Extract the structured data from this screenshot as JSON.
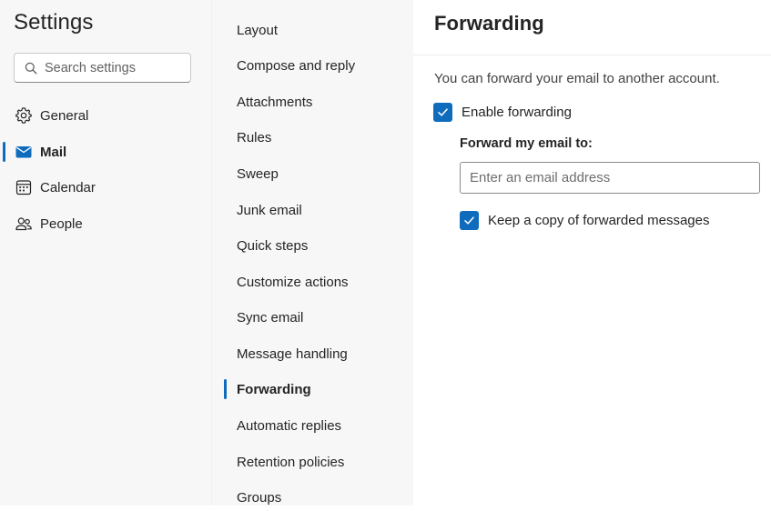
{
  "app": {
    "title": "Settings"
  },
  "search": {
    "placeholder": "Search settings",
    "icon": "search-icon"
  },
  "categories": [
    {
      "label": "General",
      "icon": "gear-icon",
      "active": false
    },
    {
      "label": "Mail",
      "icon": "mail-icon",
      "active": true
    },
    {
      "label": "Calendar",
      "icon": "calendar-icon",
      "active": false
    },
    {
      "label": "People",
      "icon": "people-icon",
      "active": false
    }
  ],
  "mail_sections": [
    {
      "label": "Layout",
      "active": false
    },
    {
      "label": "Compose and reply",
      "active": false
    },
    {
      "label": "Attachments",
      "active": false
    },
    {
      "label": "Rules",
      "active": false
    },
    {
      "label": "Sweep",
      "active": false
    },
    {
      "label": "Junk email",
      "active": false
    },
    {
      "label": "Quick steps",
      "active": false
    },
    {
      "label": "Customize actions",
      "active": false
    },
    {
      "label": "Sync email",
      "active": false
    },
    {
      "label": "Message handling",
      "active": false
    },
    {
      "label": "Forwarding",
      "active": true
    },
    {
      "label": "Automatic replies",
      "active": false
    },
    {
      "label": "Retention policies",
      "active": false
    },
    {
      "label": "Groups",
      "active": false
    }
  ],
  "forwarding": {
    "title": "Forwarding",
    "description": "You can forward your email to another account.",
    "enable_label": "Enable forwarding",
    "enable_checked": true,
    "forward_to_label": "Forward my email to:",
    "email_placeholder": "Enter an email address",
    "email_value": "",
    "keep_copy_label": "Keep a copy of forwarded messages",
    "keep_copy_checked": true
  },
  "colors": {
    "accent": "#0f6cbd",
    "pane_background": "#f7f7f7",
    "content_background": "#ffffff",
    "text": "#242424"
  }
}
